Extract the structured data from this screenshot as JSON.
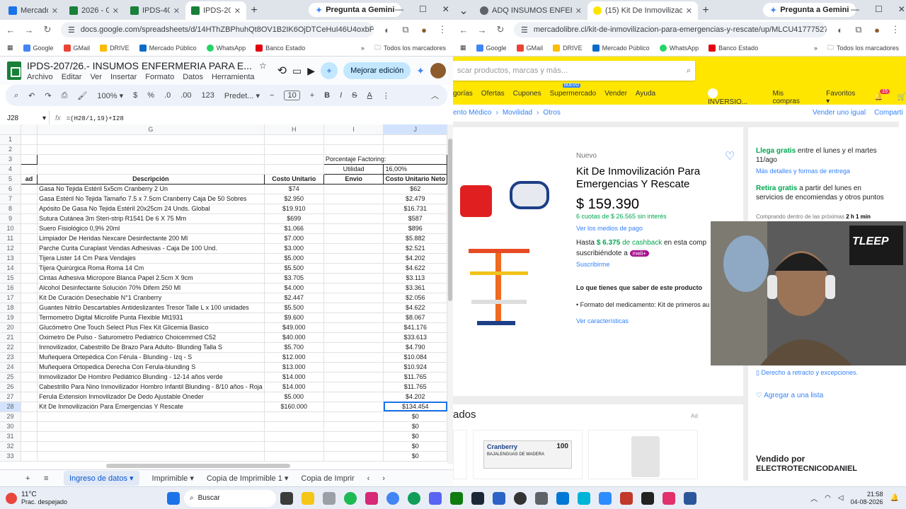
{
  "left_browser": {
    "tabs": [
      {
        "label": "Mercado p",
        "color": "#1a73e8",
        "active": false
      },
      {
        "label": "2026 - Goo",
        "color": "#188038",
        "active": false
      },
      {
        "label": "IPDS-400/",
        "color": "#188038",
        "active": false
      },
      {
        "label": "IPDS-207/",
        "color": "#188038",
        "active": true
      }
    ],
    "gemini": "Pregunta a Gemini",
    "url": "docs.google.com/spreadsheets/d/14HThZBPhuhQt8OV1B2IK6OjDTCeHuI46U4oxbPgG...",
    "bookmarks": [
      "Google",
      "GMail",
      "DRIVE",
      "Mercado Público",
      "WhatsApp",
      "Banco Estado"
    ],
    "all_bookmarks": "Todos los marcadores"
  },
  "sheets": {
    "doc_title": "IPDS-207/26.- INSUMOS ENFERMERIA PARA E...",
    "menus": [
      "Archivo",
      "Editar",
      "Ver",
      "Insertar",
      "Formato",
      "Datos",
      "Herramienta"
    ],
    "share_label": "Mejorar edición",
    "toolbar": {
      "zoom": "100%",
      "currency": "$",
      "percent": "%",
      "dec1": ".0",
      "dec2": ".00",
      "num": "123",
      "font": "Predet...",
      "font_size": "10",
      "bold": "B",
      "italic": "I",
      "strike": "S",
      "color": "A"
    },
    "cell_ref": "J28",
    "fx": "fx",
    "formula": "=(H28/1,19)+I28",
    "col_headers": [
      "G",
      "H",
      "I",
      "J"
    ],
    "factoring_label": "Porcentaje Factoring:",
    "utilidad_label": "Utilidad",
    "utilidad_value": "16,00%",
    "headers": {
      "cant": "ad",
      "desc": "Descripción",
      "costo": "Costo Unitario",
      "envio": "Envio",
      "neto": "Costo Unitario Neto"
    },
    "rows": [
      {
        "n": "6",
        "desc": "Gasa No Tejida Estéril 5x5cm Cranberry 2 Un",
        "costo": "$74",
        "neto": "$62"
      },
      {
        "n": "7",
        "desc": "Gasa Estéril No Tejida Tamaño 7.5 x 7.5cm Cranberry Caja De 50 Sobres",
        "costo": "$2.950",
        "neto": "$2.479"
      },
      {
        "n": "8",
        "desc": "Apósito De Gasa No Tejida Estéril 20x25cm 24 Unds. Global",
        "costo": "$19.910",
        "neto": "$16.731"
      },
      {
        "n": "9",
        "desc": "Sutura Cutánea 3m Steri-strip R1541 De 6 X 75 Mm",
        "costo": "$699",
        "neto": "$587"
      },
      {
        "n": "10",
        "desc": "Suero Fisiológico 0,9% 20ml",
        "costo": "$1.066",
        "neto": "$896"
      },
      {
        "n": "11",
        "desc": "Limpiador De Heridas Nexcare Desinfectante 200 Ml",
        "costo": "$7.000",
        "neto": "$5.882"
      },
      {
        "n": "12",
        "desc": "Parche Curita Curaplast Vendas Adhesivas - Caja De 100 Und.",
        "costo": "$3.000",
        "neto": "$2.521"
      },
      {
        "n": "13",
        "desc": "Tijera Lister 14 Cm Para Vendajes",
        "costo": "$5.000",
        "neto": "$4.202"
      },
      {
        "n": "14",
        "desc": "Tijera Quirúrgica Roma Roma 14 Cm",
        "costo": "$5.500",
        "neto": "$4.622"
      },
      {
        "n": "15",
        "desc": "Cintas Adhesiva Micropore Blanca Papel 2.5cm X 9cm",
        "costo": "$3.705",
        "neto": "$3.113"
      },
      {
        "n": "16",
        "desc": "Alcohol Desinfectante Solución 70% Difem 250 Ml",
        "costo": "$4.000",
        "neto": "$3.361"
      },
      {
        "n": "17",
        "desc": "Kit De Curación Desechable N°1 Cranberry",
        "costo": "$2.447",
        "neto": "$2.056"
      },
      {
        "n": "18",
        "desc": "Guantes Nitrilo Descartables Antideslizantes Tresor Talle L x 100 unidades",
        "costo": "$5.500",
        "neto": "$4.622"
      },
      {
        "n": "19",
        "desc": "Termometro Digital Microlife Punta Flexible Mt1931",
        "costo": "$9.600",
        "neto": "$8.067"
      },
      {
        "n": "20",
        "desc": "Glucómetro One Touch Select Plus Flex Kit Glicemia Basico",
        "costo": "$49.000",
        "neto": "$41.176"
      },
      {
        "n": "21",
        "desc": "Oximetro De Pulso - Saturometro Pediatrico Choicemmed C52",
        "costo": "$40.000",
        "neto": "$33.613"
      },
      {
        "n": "22",
        "desc": "Inmovilizador, Cabestrillo De Brazo Para Adulto- Blunding Talla S",
        "costo": "$5.700",
        "neto": "$4.790"
      },
      {
        "n": "23",
        "desc": "Muñequera Ortepédica Con Férula - Blunding - Izq - S",
        "costo": "$12.000",
        "neto": "$10.084"
      },
      {
        "n": "24",
        "desc": "Muñequera Ortopedica Derecha Con Ferula-blunding S",
        "costo": "$13.000",
        "neto": "$10.924"
      },
      {
        "n": "25",
        "desc": "Inmovilizador De Hombro Pediátrico Blunding - 12-14 años verde",
        "costo": "$14.000",
        "neto": "$11.765"
      },
      {
        "n": "26",
        "desc": "Cabestrillo Para Nino Inmovilizador Hombro Infantil Blunding - 8/10 años - Roja",
        "costo": "$14.000",
        "neto": "$11.765"
      },
      {
        "n": "27",
        "desc": "Ferula Extension Inmovilizador De Dedo Ajustable Oneder",
        "costo": "$5.000",
        "neto": "$4.202"
      },
      {
        "n": "28",
        "desc": "Kit De Inmovilización Para Emergencias Y Rescate",
        "costo": "$160.000",
        "neto": "$134.454"
      },
      {
        "n": "29",
        "desc": "",
        "costo": "",
        "neto": "$0"
      },
      {
        "n": "30",
        "desc": "",
        "costo": "",
        "neto": "$0"
      },
      {
        "n": "31",
        "desc": "",
        "costo": "",
        "neto": "$0"
      },
      {
        "n": "32",
        "desc": "",
        "costo": "",
        "neto": "$0"
      },
      {
        "n": "33",
        "desc": "",
        "costo": "",
        "neto": "$0"
      }
    ],
    "sheet_tabs": [
      "Ingreso de datos",
      "Imprimible",
      "Copia de Imprimible 1",
      "Copia de Imprir"
    ]
  },
  "right_browser": {
    "tabs": [
      {
        "label": "ADQ INSUMOS ENFERMERIA p",
        "color": "#5f6368",
        "active": false
      },
      {
        "label": "(15) Kit De Inmovilización Para",
        "color": "#ffe600",
        "active": true
      }
    ],
    "gemini": "Pregunta a Gemini",
    "url": "mercadolibre.cl/kit-de-inmovilizacion-para-emergencias-y-rescate/up/MLCU41777527...",
    "bookmarks": [
      "Google",
      "GMail",
      "DRIVE",
      "Mercado Público",
      "WhatsApp",
      "Banco Estado"
    ],
    "all_bookmarks": "Todos los marcadores"
  },
  "ml": {
    "search_placeholder": "scar productos, marcas y más...",
    "nav": [
      "gorías",
      "Ofertas",
      "Cupones",
      "Supermercado",
      "Vender",
      "Ayuda"
    ],
    "nuevo_badge": "NUEVO",
    "user": "INVERSIO...",
    "mis_compras": "Mis compras",
    "favoritos": "Favoritos",
    "cart_count": "15",
    "breadcrumb": [
      "ento Médico",
      "Movilidad",
      "Otros"
    ],
    "vender_igual": "Vender uno igual",
    "compartir": "Comparti",
    "condition": "Nuevo",
    "title": "Kit De Inmovilización Para Emergencias Y Rescate",
    "price": "$ 159.390",
    "cuotas": "6 cuotas de $ 26.565 sin interés",
    "medios": "Ver los medios de pago",
    "cashback_pre": "Hasta",
    "cashback_amt": "$ 6.375",
    "cashback_mid": "de cashback",
    "cashback_post": "en esta comp",
    "suscrib": "suscribiéndote a",
    "meli": "meli+",
    "suscribete": "Suscribirme",
    "must_know": "Lo que tienes que saber de este producto",
    "bullet": "Formato del medicamento: Kit de primeros au",
    "ver_caract": "Ver características",
    "llega_green": "Llega gratis",
    "llega_rest": "entre el lunes y el martes 11/ago",
    "mas_detalles": "Más detalles y formas de entrega",
    "retira_green": "Retira gratis",
    "retira_rest": "a partir del lunes en servicios de encomiendas y otros puntos",
    "comprando": "Comprando dentro de las próximas",
    "comprando_time": "2 h 1 min",
    "derecho": "Derecho a retracto y excepciones.",
    "agregar": "Agregar a una lista",
    "anuncios": "ados",
    "ad": "Ad",
    "ad_brand": "Cranberry",
    "ad_sub": "BAJALENGUAS DE MADERA",
    "ad_count": "100",
    "vendido_label": "Vendido por",
    "vendido_por": "ELECTROTECNICODANIEL"
  },
  "webcam": {
    "logo_text": "TLEEP"
  },
  "taskbar": {
    "weather_temp": "11°C",
    "weather_desc": "Prac. despejado",
    "search": "Buscar",
    "time": "21:58",
    "date": "04-08-2026"
  }
}
